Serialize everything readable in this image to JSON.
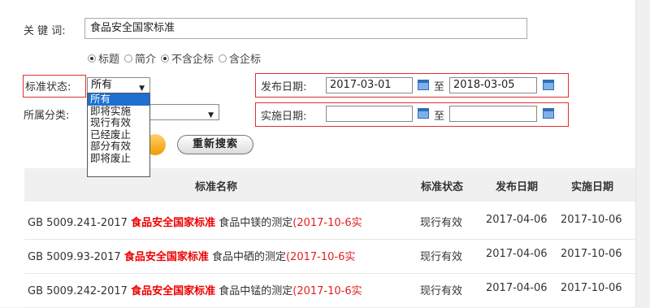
{
  "form": {
    "keyword_label": "关 键 词:",
    "keyword_value": "食品安全国家标准",
    "radio_options": [
      {
        "label": "标题",
        "checked": true
      },
      {
        "label": "简介",
        "checked": false
      },
      {
        "label": "不含企标",
        "checked": true
      },
      {
        "label": "含企标",
        "checked": false
      }
    ],
    "status_label": "标准状态:",
    "status_selected": "所有",
    "status_options": [
      "所有",
      "即将实施",
      "现行有效",
      "已经废止",
      "部分有效",
      "即将废止"
    ],
    "category_label": "所属分类:",
    "publish_date_label": "发布日期:",
    "publish_date_from": "2017-03-01",
    "publish_date_to": "2018-03-05",
    "impl_date_label": "实施日期:",
    "impl_date_from": "",
    "impl_date_to": "",
    "to_label": "至",
    "reset_label": "重新搜索"
  },
  "table": {
    "headers": [
      "标准名称",
      "标准状态",
      "发布日期",
      "实施日期"
    ],
    "rows": [
      {
        "code": "GB 5009.241-2017",
        "keyword": "食品安全国家标准",
        "title": "食品中镁的测定",
        "extra": "(2017-10-6实",
        "status": "现行有效",
        "publish": "2017-04-06",
        "implement": "2017-10-06"
      },
      {
        "code": "GB 5009.93-2017",
        "keyword": "食品安全国家标准",
        "title": "食品中硒的测定",
        "extra": "(2017-10-6实",
        "status": "现行有效",
        "publish": "2017-04-06",
        "implement": "2017-10-06"
      },
      {
        "code": "GB 5009.242-2017",
        "keyword": "食品安全国家标准",
        "title": "食品中锰的测定",
        "extra": "(2017-10-6实",
        "status": "现行有效",
        "publish": "2017-04-06",
        "implement": "2017-10-06"
      }
    ]
  },
  "colors": {
    "accent_red": "#e00000",
    "selection_blue": "#1e6fd0",
    "highlight_box": "#e03030"
  }
}
